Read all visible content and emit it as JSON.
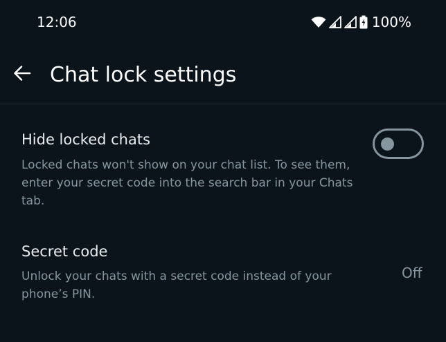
{
  "status_bar": {
    "time": "12:06",
    "battery_percent": "100%",
    "icons": [
      "wifi-icon",
      "signal-icon",
      "signal-icon",
      "battery-charging-icon"
    ]
  },
  "header": {
    "back_icon": "arrow-left-icon",
    "title": "Chat lock settings"
  },
  "settings": {
    "hide_locked_chats": {
      "title": "Hide locked chats",
      "description": "Locked chats won't show on your chat list. To see them, enter your secret code into the search bar in your Chats tab.",
      "toggle_on": false
    },
    "secret_code": {
      "title": "Secret code",
      "description": "Unlock your chats with a secret code instead of your phone’s PIN.",
      "value": "Off"
    }
  },
  "colors": {
    "background": "#0b141a",
    "primary_text": "#e9edef",
    "secondary_text": "#8696a0"
  }
}
